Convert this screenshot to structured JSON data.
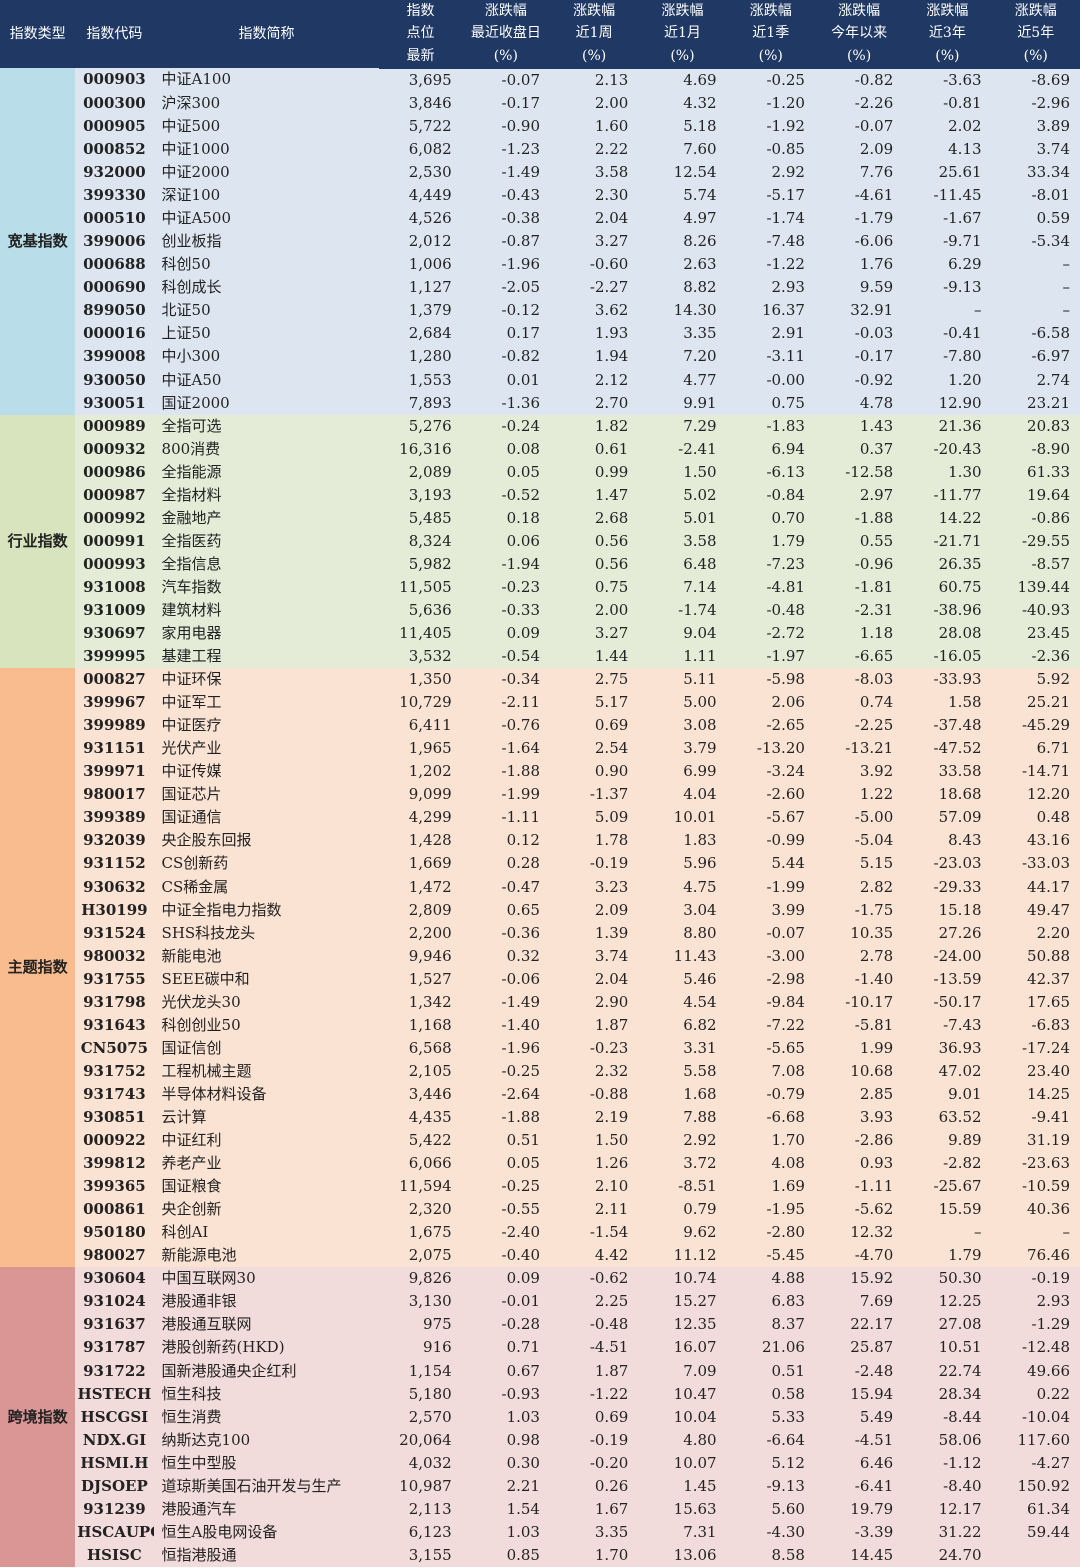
{
  "headers": {
    "type": "指数类型",
    "code": "指数代码",
    "name": "指数简称",
    "points": [
      "指数",
      "点位",
      "最新"
    ],
    "cols": [
      [
        "涨跌幅",
        "最近收盘日",
        "(%)"
      ],
      [
        "涨跌幅",
        "近1周",
        "(%)"
      ],
      [
        "涨跌幅",
        "近1月",
        "(%)"
      ],
      [
        "涨跌幅",
        "近1季",
        "(%)"
      ],
      [
        "涨跌幅",
        "今年以来",
        "(%)"
      ],
      [
        "涨跌幅",
        "近3年",
        "(%)"
      ],
      [
        "涨跌幅",
        "近5年",
        "(%)"
      ]
    ]
  },
  "colors": {
    "header": "#1f3864",
    "group_bg": [
      "#dde6f0",
      "#e4ecd8",
      "#fbe3d4",
      "#f2dcdb"
    ],
    "group_cat_bg": [
      "#b9dde9",
      "#d7e4bd",
      "#f9bc8f",
      "#d99694"
    ]
  },
  "groups": [
    {
      "category": "宽基指数",
      "rows": [
        [
          "000903",
          "中证A100",
          "3,695",
          "-0.07",
          "2.13",
          "4.69",
          "-0.25",
          "-0.82",
          "-3.63",
          "-8.69"
        ],
        [
          "000300",
          "沪深300",
          "3,846",
          "-0.17",
          "2.00",
          "4.32",
          "-1.20",
          "-2.26",
          "-0.81",
          "-2.96"
        ],
        [
          "000905",
          "中证500",
          "5,722",
          "-0.90",
          "1.60",
          "5.18",
          "-1.92",
          "-0.07",
          "2.02",
          "3.89"
        ],
        [
          "000852",
          "中证1000",
          "6,082",
          "-1.23",
          "2.22",
          "7.60",
          "-0.85",
          "2.09",
          "4.13",
          "3.74"
        ],
        [
          "932000",
          "中证2000",
          "2,530",
          "-1.49",
          "3.58",
          "12.54",
          "2.92",
          "7.76",
          "25.61",
          "33.34"
        ],
        [
          "399330",
          "深证100",
          "4,449",
          "-0.43",
          "2.30",
          "5.74",
          "-5.17",
          "-4.61",
          "-11.45",
          "-8.01"
        ],
        [
          "000510",
          "中证A500",
          "4,526",
          "-0.38",
          "2.04",
          "4.97",
          "-1.74",
          "-1.79",
          "-1.67",
          "0.59"
        ],
        [
          "399006",
          "创业板指",
          "2,012",
          "-0.87",
          "3.27",
          "8.26",
          "-7.48",
          "-6.06",
          "-9.71",
          "-5.34"
        ],
        [
          "000688",
          "科创50",
          "1,006",
          "-1.96",
          "-0.60",
          "2.63",
          "-1.22",
          "1.76",
          "6.29",
          "–"
        ],
        [
          "000690",
          "科创成长",
          "1,127",
          "-2.05",
          "-2.27",
          "8.82",
          "2.93",
          "9.59",
          "-9.13",
          "–"
        ],
        [
          "899050",
          "北证50",
          "1,379",
          "-0.12",
          "3.62",
          "14.30",
          "16.37",
          "32.91",
          "–",
          "–"
        ],
        [
          "000016",
          "上证50",
          "2,684",
          "0.17",
          "1.93",
          "3.35",
          "2.91",
          "-0.03",
          "-0.41",
          "-6.58"
        ],
        [
          "399008",
          "中小300",
          "1,280",
          "-0.82",
          "1.94",
          "7.20",
          "-3.11",
          "-0.17",
          "-7.80",
          "-6.97"
        ],
        [
          "930050",
          "中证A50",
          "1,553",
          "0.01",
          "2.12",
          "4.77",
          "-0.00",
          "-0.92",
          "1.20",
          "2.74"
        ],
        [
          "930051",
          "国证2000",
          "7,893",
          "-1.36",
          "2.70",
          "9.91",
          "0.75",
          "4.78",
          "12.90",
          "23.21"
        ]
      ]
    },
    {
      "category": "行业指数",
      "rows": [
        [
          "000989",
          "全指可选",
          "5,276",
          "-0.24",
          "1.82",
          "7.29",
          "-1.83",
          "1.43",
          "21.36",
          "20.83"
        ],
        [
          "000932",
          "800消费",
          "16,316",
          "0.08",
          "0.61",
          "-2.41",
          "6.94",
          "0.37",
          "-20.43",
          "-8.90"
        ],
        [
          "000986",
          "全指能源",
          "2,089",
          "0.05",
          "0.99",
          "1.50",
          "-6.13",
          "-12.58",
          "1.30",
          "61.33"
        ],
        [
          "000987",
          "全指材料",
          "3,193",
          "-0.52",
          "1.47",
          "5.02",
          "-0.84",
          "2.97",
          "-11.77",
          "19.64"
        ],
        [
          "000992",
          "金融地产",
          "5,485",
          "0.18",
          "2.68",
          "5.01",
          "0.70",
          "-1.88",
          "14.22",
          "-0.86"
        ],
        [
          "000991",
          "全指医药",
          "8,324",
          "0.06",
          "0.56",
          "3.58",
          "1.79",
          "0.55",
          "-21.71",
          "-29.55"
        ],
        [
          "000993",
          "全指信息",
          "5,982",
          "-1.94",
          "0.56",
          "6.48",
          "-7.23",
          "-0.96",
          "26.35",
          "-8.57"
        ],
        [
          "931008",
          "汽车指数",
          "11,505",
          "-0.23",
          "0.75",
          "7.14",
          "-4.81",
          "-1.81",
          "60.75",
          "139.44"
        ],
        [
          "931009",
          "建筑材料",
          "5,636",
          "-0.33",
          "2.00",
          "-1.74",
          "-0.48",
          "-2.31",
          "-38.96",
          "-40.93"
        ],
        [
          "930697",
          "家用电器",
          "11,405",
          "0.09",
          "3.27",
          "9.04",
          "-2.72",
          "1.18",
          "28.08",
          "23.45"
        ],
        [
          "399995",
          "基建工程",
          "3,532",
          "-0.54",
          "1.44",
          "1.11",
          "-1.97",
          "-6.65",
          "-16.05",
          "-2.36"
        ]
      ]
    },
    {
      "category": "主题指数",
      "rows": [
        [
          "000827",
          "中证环保",
          "1,350",
          "-0.34",
          "2.75",
          "5.11",
          "-5.98",
          "-8.03",
          "-33.93",
          "5.92"
        ],
        [
          "399967",
          "中证军工",
          "10,729",
          "-2.11",
          "5.17",
          "5.00",
          "2.06",
          "0.74",
          "1.58",
          "25.21"
        ],
        [
          "399989",
          "中证医疗",
          "6,411",
          "-0.76",
          "0.69",
          "3.08",
          "-2.65",
          "-2.25",
          "-37.48",
          "-45.29"
        ],
        [
          "931151",
          "光伏产业",
          "1,965",
          "-1.64",
          "2.54",
          "3.79",
          "-13.20",
          "-13.21",
          "-47.52",
          "6.71"
        ],
        [
          "399971",
          "中证传媒",
          "1,202",
          "-1.88",
          "0.90",
          "6.99",
          "-3.24",
          "3.92",
          "33.58",
          "-14.71"
        ],
        [
          "980017",
          "国证芯片",
          "9,099",
          "-1.99",
          "-1.37",
          "4.04",
          "-2.60",
          "1.22",
          "18.68",
          "12.20"
        ],
        [
          "399389",
          "国证通信",
          "4,299",
          "-1.11",
          "5.09",
          "10.01",
          "-5.67",
          "-5.00",
          "57.09",
          "0.48"
        ],
        [
          "932039",
          "央企股东回报",
          "1,428",
          "0.12",
          "1.78",
          "1.83",
          "-0.99",
          "-5.04",
          "8.43",
          "43.16"
        ],
        [
          "931152",
          "CS创新药",
          "1,669",
          "0.28",
          "-0.19",
          "5.96",
          "5.44",
          "5.15",
          "-23.03",
          "-33.03"
        ],
        [
          "930632",
          "CS稀金属",
          "1,472",
          "-0.47",
          "3.23",
          "4.75",
          "-1.99",
          "2.82",
          "-29.33",
          "44.17"
        ],
        [
          "H30199",
          "中证全指电力指数",
          "2,809",
          "0.65",
          "2.09",
          "3.04",
          "3.99",
          "-1.75",
          "15.18",
          "49.47"
        ],
        [
          "931524",
          "SHS科技龙头",
          "2,200",
          "-0.36",
          "1.39",
          "8.80",
          "-0.07",
          "10.35",
          "27.26",
          "2.20"
        ],
        [
          "980032",
          "新能电池",
          "9,946",
          "0.32",
          "3.74",
          "11.43",
          "-3.00",
          "2.78",
          "-24.00",
          "50.88"
        ],
        [
          "931755",
          "SEEE碳中和",
          "1,527",
          "-0.06",
          "2.04",
          "5.46",
          "-2.98",
          "-1.40",
          "-13.59",
          "42.37"
        ],
        [
          "931798",
          "光伏龙头30",
          "1,342",
          "-1.49",
          "2.90",
          "4.54",
          "-9.84",
          "-10.17",
          "-50.17",
          "17.65"
        ],
        [
          "931643",
          "科创创业50",
          "1,168",
          "-1.40",
          "1.87",
          "6.82",
          "-7.22",
          "-5.81",
          "-7.43",
          "-6.83"
        ],
        [
          "CN5075",
          "国证信创",
          "6,568",
          "-1.96",
          "-0.23",
          "3.31",
          "-5.65",
          "1.99",
          "36.93",
          "-17.24"
        ],
        [
          "931752",
          "工程机械主题",
          "2,105",
          "-0.25",
          "2.32",
          "5.58",
          "7.08",
          "10.68",
          "47.02",
          "23.40"
        ],
        [
          "931743",
          "半导体材料设备",
          "3,446",
          "-2.64",
          "-0.88",
          "1.68",
          "-0.79",
          "2.85",
          "9.01",
          "14.25"
        ],
        [
          "930851",
          "云计算",
          "4,435",
          "-1.88",
          "2.19",
          "7.88",
          "-6.68",
          "3.93",
          "63.52",
          "-9.41"
        ],
        [
          "000922",
          "中证红利",
          "5,422",
          "0.51",
          "1.50",
          "2.92",
          "1.70",
          "-2.86",
          "9.89",
          "31.19"
        ],
        [
          "399812",
          "养老产业",
          "6,066",
          "0.05",
          "1.26",
          "3.72",
          "4.08",
          "0.93",
          "-2.82",
          "-23.63"
        ],
        [
          "399365",
          "国证粮食",
          "11,594",
          "-0.25",
          "2.10",
          "-8.51",
          "1.69",
          "-1.11",
          "-25.67",
          "-10.59"
        ],
        [
          "000861",
          "央企创新",
          "2,320",
          "-0.55",
          "2.11",
          "0.79",
          "-1.95",
          "-5.62",
          "15.59",
          "40.36"
        ],
        [
          "950180",
          "科创AI",
          "1,675",
          "-2.40",
          "-1.54",
          "9.62",
          "-2.80",
          "12.32",
          "–",
          "–"
        ],
        [
          "980027",
          "新能源电池",
          "2,075",
          "-0.40",
          "4.42",
          "11.12",
          "-5.45",
          "-4.70",
          "1.79",
          "76.46"
        ]
      ]
    },
    {
      "category": "跨境指数",
      "rows": [
        [
          "930604",
          "中国互联网30",
          "9,826",
          "0.09",
          "-0.62",
          "10.74",
          "4.88",
          "15.92",
          "50.30",
          "-0.19"
        ],
        [
          "931024",
          "港股通非银",
          "3,130",
          "-0.01",
          "2.25",
          "15.27",
          "6.83",
          "7.69",
          "12.25",
          "2.93"
        ],
        [
          "931637",
          "港股通互联网",
          "975",
          "-0.28",
          "-0.48",
          "12.35",
          "8.37",
          "22.17",
          "27.08",
          "-1.29"
        ],
        [
          "931787",
          "港股创新药(HKD)",
          "916",
          "0.71",
          "-4.51",
          "16.07",
          "21.06",
          "25.87",
          "10.51",
          "-12.48"
        ],
        [
          "931722",
          "国新港股通央企红利",
          "1,154",
          "0.67",
          "1.87",
          "7.09",
          "0.51",
          "-2.48",
          "22.74",
          "49.66"
        ],
        [
          "HSTECH",
          "恒生科技",
          "5,180",
          "-0.93",
          "-1.22",
          "10.47",
          "0.58",
          "15.94",
          "28.34",
          "0.22"
        ],
        [
          "HSCGSI",
          "恒生消费",
          "2,570",
          "1.03",
          "0.69",
          "10.04",
          "5.33",
          "5.49",
          "-8.44",
          "-10.04"
        ],
        [
          "NDX.GI",
          "纳斯达克100",
          "20,064",
          "0.98",
          "-0.19",
          "4.80",
          "-6.64",
          "-4.51",
          "58.06",
          "117.60"
        ],
        [
          "HSMI.H",
          "恒生中型股",
          "4,032",
          "0.30",
          "-0.20",
          "10.07",
          "5.12",
          "6.46",
          "-1.12",
          "-4.27"
        ],
        [
          "DJSOEP",
          "道琼斯美国石油开发与生产",
          "10,987",
          "2.21",
          "0.26",
          "1.45",
          "-9.13",
          "-6.41",
          "-8.40",
          "150.92"
        ],
        [
          "931239",
          "港股通汽车",
          "2,113",
          "1.54",
          "1.67",
          "15.63",
          "5.60",
          "19.79",
          "12.17",
          "61.34"
        ],
        [
          "HSCAUPG",
          "恒生A股电网设备",
          "6,123",
          "1.03",
          "3.35",
          "7.31",
          "-4.30",
          "-3.39",
          "31.22",
          "59.44"
        ],
        [
          "HSISC",
          "恒指港股通",
          "3,155",
          "0.85",
          "1.70",
          "13.06",
          "8.58",
          "14.45",
          "24.70",
          ""
        ]
      ]
    }
  ]
}
